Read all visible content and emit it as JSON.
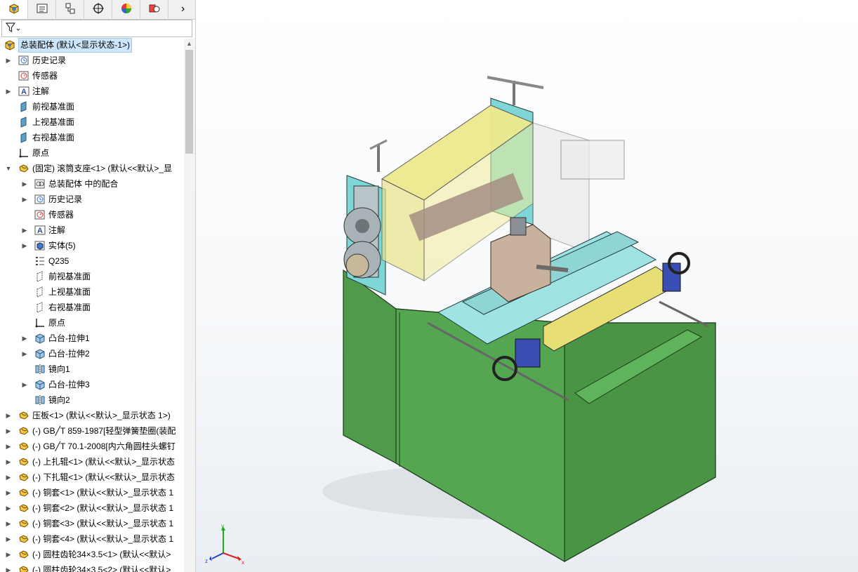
{
  "tabs": [
    {
      "icon": "feature-manager-icon",
      "active": true
    },
    {
      "icon": "property-manager-icon",
      "active": false
    },
    {
      "icon": "configuration-manager-icon",
      "active": false
    },
    {
      "icon": "dimxpert-icon",
      "active": false
    },
    {
      "icon": "display-manager-icon",
      "active": false
    },
    {
      "icon": "cam-icon",
      "active": false
    }
  ],
  "filter": {
    "icon": "filter-icon"
  },
  "tree": [
    {
      "level": 0,
      "expander": "",
      "icon": "assembly-icon",
      "label": "总装配体 (默认<显示状态-1>)",
      "selected": true
    },
    {
      "level": 1,
      "expander": "▶",
      "icon": "history-icon",
      "label": "历史记录"
    },
    {
      "level": 1,
      "expander": "",
      "icon": "sensor-icon",
      "label": "传感器"
    },
    {
      "level": 1,
      "expander": "▶",
      "icon": "annotation-icon",
      "label": "注解"
    },
    {
      "level": 1,
      "expander": "",
      "icon": "plane-icon",
      "label": "前视基准面"
    },
    {
      "level": 1,
      "expander": "",
      "icon": "plane-icon",
      "label": "上视基准面"
    },
    {
      "level": 1,
      "expander": "",
      "icon": "plane-icon",
      "label": "右视基准面"
    },
    {
      "level": 1,
      "expander": "",
      "icon": "origin-icon",
      "label": "原点"
    },
    {
      "level": 1,
      "expander": "▼",
      "icon": "part-icon",
      "label": "(固定) 滚筒支座<1> (默认<<默认>_显"
    },
    {
      "level": 2,
      "expander": "▶",
      "icon": "mates-icon",
      "label": "总装配体 中的配合"
    },
    {
      "level": 2,
      "expander": "▶",
      "icon": "history-icon",
      "label": "历史记录"
    },
    {
      "level": 2,
      "expander": "",
      "icon": "sensor-icon",
      "label": "传感器"
    },
    {
      "level": 2,
      "expander": "▶",
      "icon": "annotation-icon",
      "label": "注解"
    },
    {
      "level": 2,
      "expander": "▶",
      "icon": "solid-bodies-icon",
      "label": "实体(5)"
    },
    {
      "level": 2,
      "expander": "",
      "icon": "material-icon",
      "label": "Q235"
    },
    {
      "level": 2,
      "expander": "",
      "icon": "plane-outline-icon",
      "label": "前视基准面"
    },
    {
      "level": 2,
      "expander": "",
      "icon": "plane-outline-icon",
      "label": "上视基准面"
    },
    {
      "level": 2,
      "expander": "",
      "icon": "plane-outline-icon",
      "label": "右视基准面"
    },
    {
      "level": 2,
      "expander": "",
      "icon": "origin-icon",
      "label": "原点"
    },
    {
      "level": 2,
      "expander": "▶",
      "icon": "extrude-icon",
      "label": "凸台-拉伸1"
    },
    {
      "level": 2,
      "expander": "▶",
      "icon": "extrude-icon",
      "label": "凸台-拉伸2"
    },
    {
      "level": 2,
      "expander": "",
      "icon": "mirror-icon",
      "label": "镜向1"
    },
    {
      "level": 2,
      "expander": "▶",
      "icon": "extrude-icon",
      "label": "凸台-拉伸3"
    },
    {
      "level": 2,
      "expander": "",
      "icon": "mirror-icon",
      "label": "镜向2"
    },
    {
      "level": 1,
      "expander": "▶",
      "icon": "part-icon",
      "label": "压板<1> (默认<<默认>_显示状态 1>)"
    },
    {
      "level": 1,
      "expander": "▶",
      "icon": "part-icon",
      "label": "(-) GB╱T 859-1987[轻型弹簧垫圈(装配"
    },
    {
      "level": 1,
      "expander": "▶",
      "icon": "part-icon",
      "label": "(-) GB╱T 70.1-2008[内六角圆柱头螺钉"
    },
    {
      "level": 1,
      "expander": "▶",
      "icon": "part-icon",
      "label": "(-) 上扎辊<1> (默认<<默认>_显示状态"
    },
    {
      "level": 1,
      "expander": "▶",
      "icon": "part-icon",
      "label": "(-) 下扎辊<1> (默认<<默认>_显示状态"
    },
    {
      "level": 1,
      "expander": "▶",
      "icon": "part-icon",
      "label": "(-) 铜套<1> (默认<<默认>_显示状态 1"
    },
    {
      "level": 1,
      "expander": "▶",
      "icon": "part-icon",
      "label": "(-) 铜套<2> (默认<<默认>_显示状态 1"
    },
    {
      "level": 1,
      "expander": "▶",
      "icon": "part-icon",
      "label": "(-) 铜套<3> (默认<<默认>_显示状态 1"
    },
    {
      "level": 1,
      "expander": "▶",
      "icon": "part-icon",
      "label": "(-) 铜套<4> (默认<<默认>_显示状态 1"
    },
    {
      "level": 1,
      "expander": "▶",
      "icon": "part-icon",
      "label": "(-) 圆柱齿轮34×3.5<1> (默认<<默认>"
    },
    {
      "level": 1,
      "expander": "▶",
      "icon": "part-icon",
      "label": "(-) 圆柱齿轮34×3.5<2> (默认<<默认>"
    }
  ],
  "triad": {
    "x_label": "x",
    "y_label": "y",
    "z_label": "z"
  },
  "colors": {
    "base": "#4e9a4a",
    "frame": "#7fd6d6",
    "guard": "#ede98a",
    "slide": "#9fe3e3",
    "motor": "#3a4fb3"
  }
}
